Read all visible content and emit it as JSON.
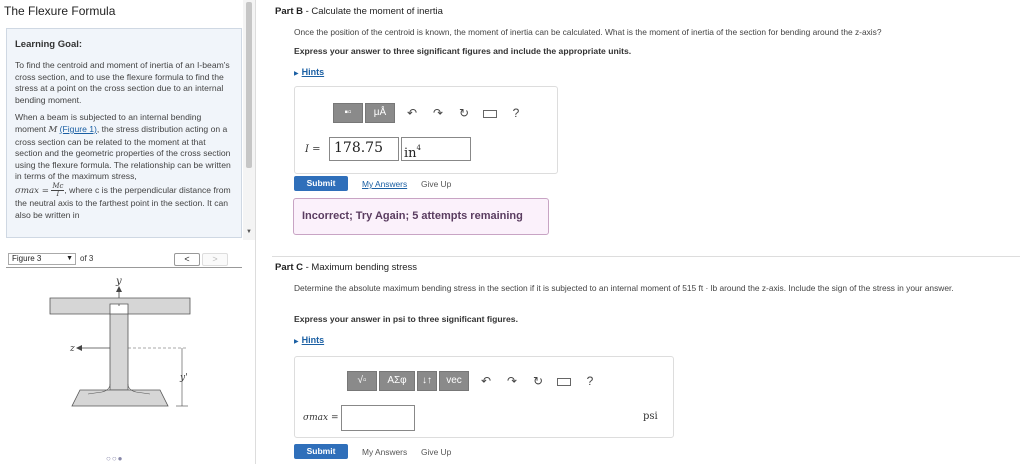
{
  "app": {
    "title": "The Flexure Formula"
  },
  "learning_goal": {
    "heading": "Learning Goal:",
    "para1": "To find the centroid and moment of inertia of an I-beam's cross section, and to use the flexure formula to find the stress at a point on the cross section due to an internal bending moment.",
    "para2_a": "When a beam is subjected to an internal bending moment ",
    "para2_m": "M",
    "para2_link": "(Figure 1)",
    "para2_b": ", the stress distribution acting on a cross section can be related to the moment at that section and the geometric properties of the cross section using the flexure formula. The relationship can be written in terms of the maximum stress,",
    "formula_lhs": "σmax =",
    "formula_num": "Mc",
    "formula_den": "I",
    "para3_a": ", where c is the perpendicular distance from the neutral axis to the farthest point in the section. It can also be written in"
  },
  "figure_nav": {
    "select_value": "Figure 3",
    "of_text": "of 3",
    "prev_glyph": "<",
    "next_glyph": ">",
    "dots": "○○●"
  },
  "figure_labels": {
    "y": "y",
    "z": "z",
    "ybar": "y'"
  },
  "part_b": {
    "label": "Part B",
    "title": " - Calculate the moment of inertia",
    "question": "Once the position of the centroid is known, the moment of inertia can be calculated. What is the moment of inertia of the section for bending around the z-axis?",
    "instruction": "Express your answer to three significant figures and include the appropriate units.",
    "hints": "Hints",
    "toolbar": {
      "b1": "▪▫",
      "b2": "μÅ",
      "help": "?"
    },
    "var": "I =",
    "value": "178.75",
    "unit": "in",
    "unit_exp": "4",
    "submit": "Submit",
    "my_answers": "My Answers",
    "give_up": "Give Up",
    "feedback": "Incorrect; Try Again; 5 attempts remaining"
  },
  "part_c": {
    "label": "Part C",
    "title": " - Maximum bending stress",
    "question": "Determine the absolute maximum bending stress in the section if it is subjected to an internal moment of 515 ft · lb around the z-axis. Include the sign of the stress in your answer.",
    "instruction": "Express your answer in psi to three significant figures.",
    "hints": "Hints",
    "toolbar": {
      "b1": "√▫",
      "b2": "ΑΣφ",
      "b3": "↓↑",
      "b4": "vec",
      "help": "?"
    },
    "var": "σmax =",
    "value": "",
    "unit": "psi",
    "submit": "Submit",
    "my_answers": "My Answers",
    "give_up": "Give Up"
  }
}
